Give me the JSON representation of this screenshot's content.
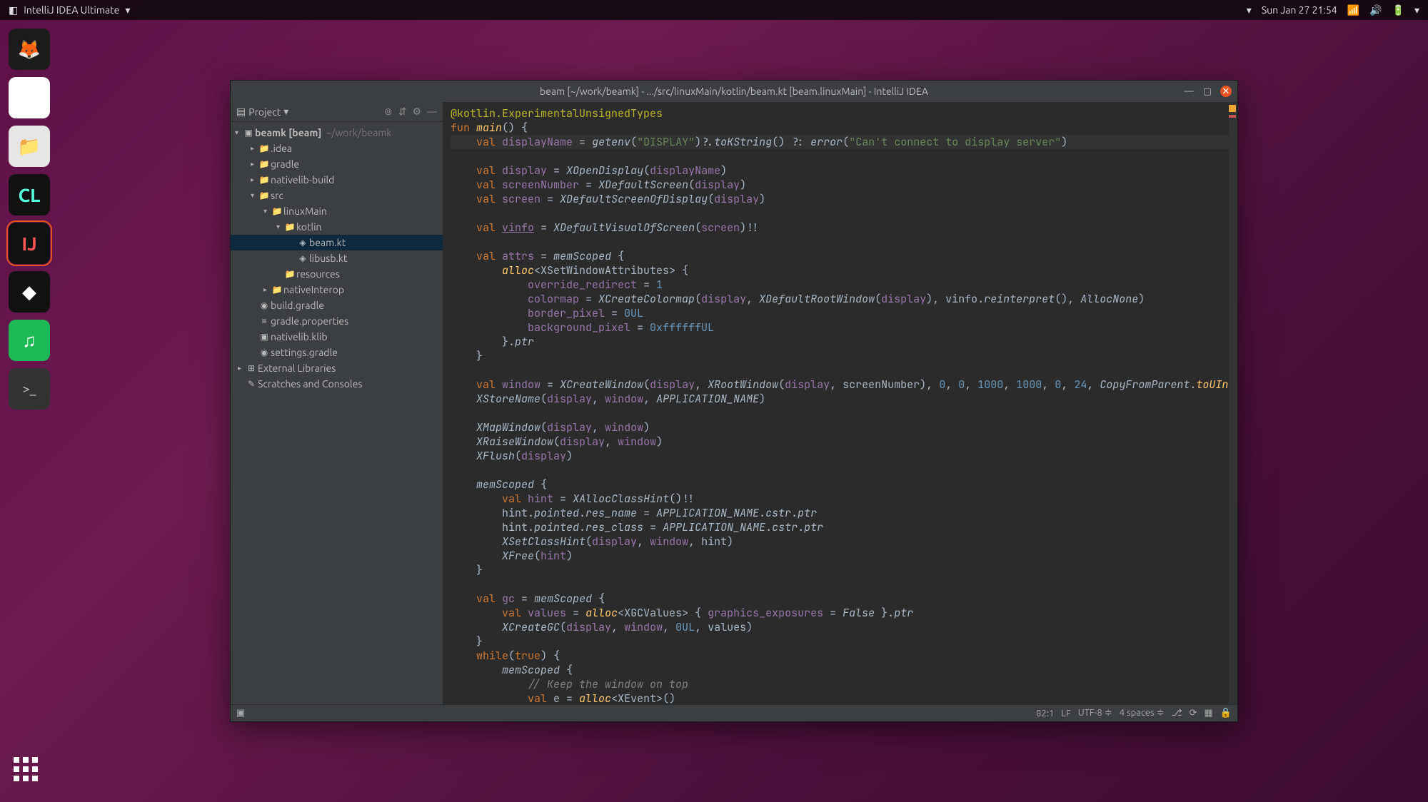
{
  "topbar": {
    "app_name": "IntelliJ IDEA Ultimate",
    "datetime": "Sun Jan 27  21:54"
  },
  "dock": {
    "firefox": "firefox",
    "chrome": "chrome",
    "files": "files",
    "clion": "CL",
    "intellij": "IJ",
    "jbtool": "jetbrains-toolbox",
    "spotify": "spotify",
    "terminal": "terminal",
    "showapps": "show-applications"
  },
  "ide": {
    "title": "beam [~/work/beamk] - .../src/linuxMain/kotlin/beam.kt [beam.linuxMain] - IntelliJ IDEA",
    "sidebar": {
      "title": "Project",
      "root": {
        "name": "beamk [beam]",
        "path": "~/work/beamk"
      },
      "items": [
        {
          "indent": 1,
          "name": ".idea",
          "type": "folder",
          "expand": "closed"
        },
        {
          "indent": 1,
          "name": "gradle",
          "type": "folder",
          "expand": "closed"
        },
        {
          "indent": 1,
          "name": "nativelib-build",
          "type": "folder",
          "expand": "closed"
        },
        {
          "indent": 1,
          "name": "src",
          "type": "folder",
          "expand": "open"
        },
        {
          "indent": 2,
          "name": "linuxMain",
          "type": "srcfolder",
          "expand": "open"
        },
        {
          "indent": 3,
          "name": "kotlin",
          "type": "srcfolder",
          "expand": "open"
        },
        {
          "indent": 4,
          "name": "beam.kt",
          "type": "kt",
          "selected": true
        },
        {
          "indent": 4,
          "name": "libusb.kt",
          "type": "kt"
        },
        {
          "indent": 3,
          "name": "resources",
          "type": "resfolder"
        },
        {
          "indent": 2,
          "name": "nativeInterop",
          "type": "srcfolder",
          "expand": "closed"
        },
        {
          "indent": 1,
          "name": "build.gradle",
          "type": "gradle"
        },
        {
          "indent": 1,
          "name": "gradle.properties",
          "type": "prop"
        },
        {
          "indent": 1,
          "name": "nativelib.klib",
          "type": "lib"
        },
        {
          "indent": 1,
          "name": "settings.gradle",
          "type": "gradle"
        },
        {
          "indent": 0,
          "name": "External Libraries",
          "type": "ext",
          "expand": "closed"
        },
        {
          "indent": 0,
          "name": "Scratches and Consoles",
          "type": "scratch"
        }
      ]
    },
    "status": {
      "pos": "82:1",
      "sep": "LF",
      "enc": "UTF-8",
      "indent": "4 spaces"
    },
    "code_tokens": [
      [
        {
          "t": "@kotlin.ExperimentalUnsignedTypes",
          "c": "ann"
        }
      ],
      [
        {
          "t": "fun ",
          "c": "kw"
        },
        {
          "t": "main",
          "c": "fn"
        },
        {
          "t": "() {",
          "c": ""
        }
      ],
      [
        {
          "t": "    ",
          "c": ""
        },
        {
          "t": "val ",
          "c": "kw"
        },
        {
          "t": "displayName",
          "c": "prop"
        },
        {
          "t": " = ",
          "c": ""
        },
        {
          "t": "getenv",
          "c": "typ"
        },
        {
          "t": "(",
          "c": ""
        },
        {
          "t": "\"DISPLAY\"",
          "c": "str"
        },
        {
          "t": ")?.",
          "c": ""
        },
        {
          "t": "toKString",
          "c": "typ"
        },
        {
          "t": "() ?: ",
          "c": ""
        },
        {
          "t": "error",
          "c": "typ"
        },
        {
          "t": "(",
          "c": ""
        },
        {
          "t": "\"Can't connect to display server\"",
          "c": "str"
        },
        {
          "t": ")",
          "c": ""
        }
      ],
      [],
      [
        {
          "t": "    ",
          "c": ""
        },
        {
          "t": "val ",
          "c": "kw"
        },
        {
          "t": "display",
          "c": "prop"
        },
        {
          "t": " = ",
          "c": ""
        },
        {
          "t": "XOpenDisplay",
          "c": "typ"
        },
        {
          "t": "(",
          "c": ""
        },
        {
          "t": "displayName",
          "c": "prop"
        },
        {
          "t": ")",
          "c": ""
        }
      ],
      [
        {
          "t": "    ",
          "c": ""
        },
        {
          "t": "val ",
          "c": "kw"
        },
        {
          "t": "screenNumber",
          "c": "prop"
        },
        {
          "t": " = ",
          "c": ""
        },
        {
          "t": "XDefaultScreen",
          "c": "typ"
        },
        {
          "t": "(",
          "c": ""
        },
        {
          "t": "display",
          "c": "prop"
        },
        {
          "t": ")",
          "c": ""
        }
      ],
      [
        {
          "t": "    ",
          "c": ""
        },
        {
          "t": "val ",
          "c": "kw"
        },
        {
          "t": "screen",
          "c": "prop"
        },
        {
          "t": " = ",
          "c": ""
        },
        {
          "t": "XDefaultScreenOfDisplay",
          "c": "typ"
        },
        {
          "t": "(",
          "c": ""
        },
        {
          "t": "display",
          "c": "prop"
        },
        {
          "t": ")",
          "c": ""
        }
      ],
      [],
      [
        {
          "t": "    ",
          "c": ""
        },
        {
          "t": "val ",
          "c": "kw"
        },
        {
          "t": "vinfo",
          "c": "prop und"
        },
        {
          "t": " = ",
          "c": ""
        },
        {
          "t": "XDefaultVisualOfScreen",
          "c": "typ"
        },
        {
          "t": "(",
          "c": ""
        },
        {
          "t": "screen",
          "c": "prop"
        },
        {
          "t": ")!!",
          "c": ""
        }
      ],
      [],
      [
        {
          "t": "    ",
          "c": ""
        },
        {
          "t": "val ",
          "c": "kw"
        },
        {
          "t": "attrs",
          "c": "prop"
        },
        {
          "t": " = ",
          "c": ""
        },
        {
          "t": "memScoped ",
          "c": "typ"
        },
        {
          "t": "{",
          "c": ""
        }
      ],
      [
        {
          "t": "        ",
          "c": ""
        },
        {
          "t": "alloc",
          "c": "fn"
        },
        {
          "t": "<",
          "c": ""
        },
        {
          "t": "XSetWindowAttributes",
          "c": ""
        },
        {
          "t": "> {",
          "c": ""
        }
      ],
      [
        {
          "t": "            ",
          "c": ""
        },
        {
          "t": "override_redirect",
          "c": "prop"
        },
        {
          "t": " = ",
          "c": ""
        },
        {
          "t": "1",
          "c": "num"
        }
      ],
      [
        {
          "t": "            ",
          "c": ""
        },
        {
          "t": "colormap",
          "c": "prop"
        },
        {
          "t": " = ",
          "c": ""
        },
        {
          "t": "XCreateColormap",
          "c": "typ"
        },
        {
          "t": "(",
          "c": ""
        },
        {
          "t": "display",
          "c": "prop"
        },
        {
          "t": ", ",
          "c": ""
        },
        {
          "t": "XDefaultRootWindow",
          "c": "typ"
        },
        {
          "t": "(",
          "c": ""
        },
        {
          "t": "display",
          "c": "prop"
        },
        {
          "t": "), vinfo.",
          "c": ""
        },
        {
          "t": "reinterpret",
          "c": "typ"
        },
        {
          "t": "(), ",
          "c": ""
        },
        {
          "t": "AllocNone",
          "c": "typ"
        },
        {
          "t": ")",
          "c": ""
        }
      ],
      [
        {
          "t": "            ",
          "c": ""
        },
        {
          "t": "border_pixel",
          "c": "prop"
        },
        {
          "t": " = ",
          "c": ""
        },
        {
          "t": "0UL",
          "c": "num"
        }
      ],
      [
        {
          "t": "            ",
          "c": ""
        },
        {
          "t": "background_pixel",
          "c": "prop"
        },
        {
          "t": " = ",
          "c": ""
        },
        {
          "t": "0xffffffUL",
          "c": "num"
        }
      ],
      [
        {
          "t": "        }.",
          "c": ""
        },
        {
          "t": "ptr",
          "c": "typ"
        }
      ],
      [
        {
          "t": "    }",
          "c": ""
        }
      ],
      [],
      [
        {
          "t": "    ",
          "c": ""
        },
        {
          "t": "val ",
          "c": "kw"
        },
        {
          "t": "window",
          "c": "prop"
        },
        {
          "t": " = ",
          "c": ""
        },
        {
          "t": "XCreateWindow",
          "c": "typ"
        },
        {
          "t": "(",
          "c": ""
        },
        {
          "t": "display",
          "c": "prop"
        },
        {
          "t": ", ",
          "c": ""
        },
        {
          "t": "XRootWindow",
          "c": "typ"
        },
        {
          "t": "(",
          "c": ""
        },
        {
          "t": "display",
          "c": "prop"
        },
        {
          "t": ", screenNumber), ",
          "c": ""
        },
        {
          "t": "0",
          "c": "num"
        },
        {
          "t": ", ",
          "c": ""
        },
        {
          "t": "0",
          "c": "num"
        },
        {
          "t": ", ",
          "c": ""
        },
        {
          "t": "1000",
          "c": "num"
        },
        {
          "t": ", ",
          "c": ""
        },
        {
          "t": "1000",
          "c": "num"
        },
        {
          "t": ", ",
          "c": ""
        },
        {
          "t": "0",
          "c": "num"
        },
        {
          "t": ", ",
          "c": ""
        },
        {
          "t": "24",
          "c": "num"
        },
        {
          "t": ", ",
          "c": ""
        },
        {
          "t": "CopyFromParent",
          "c": "typ"
        },
        {
          "t": ".",
          "c": ""
        },
        {
          "t": "toUInt",
          "c": "fn"
        }
      ],
      [
        {
          "t": "    ",
          "c": ""
        },
        {
          "t": "XStoreName",
          "c": "typ"
        },
        {
          "t": "(",
          "c": ""
        },
        {
          "t": "display",
          "c": "prop"
        },
        {
          "t": ", ",
          "c": ""
        },
        {
          "t": "window",
          "c": "prop"
        },
        {
          "t": ", ",
          "c": ""
        },
        {
          "t": "APPLICATION_NAME",
          "c": "typ"
        },
        {
          "t": ")",
          "c": ""
        }
      ],
      [],
      [
        {
          "t": "    ",
          "c": ""
        },
        {
          "t": "XMapWindow",
          "c": "typ"
        },
        {
          "t": "(",
          "c": ""
        },
        {
          "t": "display",
          "c": "prop"
        },
        {
          "t": ", ",
          "c": ""
        },
        {
          "t": "window",
          "c": "prop"
        },
        {
          "t": ")",
          "c": ""
        }
      ],
      [
        {
          "t": "    ",
          "c": ""
        },
        {
          "t": "XRaiseWindow",
          "c": "typ"
        },
        {
          "t": "(",
          "c": ""
        },
        {
          "t": "display",
          "c": "prop"
        },
        {
          "t": ", ",
          "c": ""
        },
        {
          "t": "window",
          "c": "prop"
        },
        {
          "t": ")",
          "c": ""
        }
      ],
      [
        {
          "t": "    ",
          "c": ""
        },
        {
          "t": "XFlush",
          "c": "typ"
        },
        {
          "t": "(",
          "c": ""
        },
        {
          "t": "display",
          "c": "prop"
        },
        {
          "t": ")",
          "c": ""
        }
      ],
      [],
      [
        {
          "t": "    ",
          "c": ""
        },
        {
          "t": "memScoped ",
          "c": "typ"
        },
        {
          "t": "{",
          "c": ""
        }
      ],
      [
        {
          "t": "        ",
          "c": ""
        },
        {
          "t": "val ",
          "c": "kw"
        },
        {
          "t": "hint",
          "c": "prop"
        },
        {
          "t": " = ",
          "c": ""
        },
        {
          "t": "XAllocClassHint",
          "c": "typ"
        },
        {
          "t": "()!!",
          "c": ""
        }
      ],
      [
        {
          "t": "        hint.",
          "c": ""
        },
        {
          "t": "pointed",
          "c": "typ"
        },
        {
          "t": ".",
          "c": ""
        },
        {
          "t": "res_name",
          "c": "typ"
        },
        {
          "t": " = ",
          "c": ""
        },
        {
          "t": "APPLICATION_NAME",
          "c": "typ"
        },
        {
          "t": ".",
          "c": ""
        },
        {
          "t": "cstr",
          "c": "typ"
        },
        {
          "t": ".",
          "c": ""
        },
        {
          "t": "ptr",
          "c": "typ"
        }
      ],
      [
        {
          "t": "        hint.",
          "c": ""
        },
        {
          "t": "pointed",
          "c": "typ"
        },
        {
          "t": ".",
          "c": ""
        },
        {
          "t": "res_class",
          "c": "typ"
        },
        {
          "t": " = ",
          "c": ""
        },
        {
          "t": "APPLICATION_NAME",
          "c": "typ"
        },
        {
          "t": ".",
          "c": ""
        },
        {
          "t": "cstr",
          "c": "typ"
        },
        {
          "t": ".",
          "c": ""
        },
        {
          "t": "ptr",
          "c": "typ"
        }
      ],
      [
        {
          "t": "        ",
          "c": ""
        },
        {
          "t": "XSetClassHint",
          "c": "typ"
        },
        {
          "t": "(",
          "c": ""
        },
        {
          "t": "display",
          "c": "prop"
        },
        {
          "t": ", ",
          "c": ""
        },
        {
          "t": "window",
          "c": "prop"
        },
        {
          "t": ", hint)",
          "c": ""
        }
      ],
      [
        {
          "t": "        ",
          "c": ""
        },
        {
          "t": "XFree",
          "c": "typ"
        },
        {
          "t": "(",
          "c": ""
        },
        {
          "t": "hint",
          "c": "prop"
        },
        {
          "t": ")",
          "c": ""
        }
      ],
      [
        {
          "t": "    }",
          "c": ""
        }
      ],
      [],
      [
        {
          "t": "    ",
          "c": ""
        },
        {
          "t": "val ",
          "c": "kw"
        },
        {
          "t": "gc",
          "c": "prop"
        },
        {
          "t": " = ",
          "c": ""
        },
        {
          "t": "memScoped ",
          "c": "typ"
        },
        {
          "t": "{",
          "c": ""
        }
      ],
      [
        {
          "t": "        ",
          "c": ""
        },
        {
          "t": "val ",
          "c": "kw"
        },
        {
          "t": "values",
          "c": "prop"
        },
        {
          "t": " = ",
          "c": ""
        },
        {
          "t": "alloc",
          "c": "fn"
        },
        {
          "t": "<",
          "c": ""
        },
        {
          "t": "XGCValues",
          "c": ""
        },
        {
          "t": "> { ",
          "c": ""
        },
        {
          "t": "graphics_exposures",
          "c": "prop"
        },
        {
          "t": " = ",
          "c": ""
        },
        {
          "t": "False",
          "c": "typ"
        },
        {
          "t": " }.",
          "c": ""
        },
        {
          "t": "ptr",
          "c": "typ"
        }
      ],
      [
        {
          "t": "        ",
          "c": ""
        },
        {
          "t": "XCreateGC",
          "c": "typ"
        },
        {
          "t": "(",
          "c": ""
        },
        {
          "t": "display",
          "c": "prop"
        },
        {
          "t": ", ",
          "c": ""
        },
        {
          "t": "window",
          "c": "prop"
        },
        {
          "t": ", ",
          "c": ""
        },
        {
          "t": "0UL",
          "c": "num"
        },
        {
          "t": ", values)",
          "c": ""
        }
      ],
      [
        {
          "t": "    }",
          "c": ""
        }
      ],
      [
        {
          "t": "    ",
          "c": ""
        },
        {
          "t": "while",
          "c": "kw"
        },
        {
          "t": "(",
          "c": ""
        },
        {
          "t": "true",
          "c": "kw"
        },
        {
          "t": ") {",
          "c": ""
        }
      ],
      [
        {
          "t": "        ",
          "c": ""
        },
        {
          "t": "memScoped ",
          "c": "typ"
        },
        {
          "t": "{",
          "c": ""
        }
      ],
      [
        {
          "t": "            ",
          "c": ""
        },
        {
          "t": "// Keep the window on top",
          "c": "cmt"
        }
      ],
      [
        {
          "t": "            ",
          "c": ""
        },
        {
          "t": "val ",
          "c": "kw"
        },
        {
          "t": "e = ",
          "c": ""
        },
        {
          "t": "alloc",
          "c": "fn"
        },
        {
          "t": "<XEvent>()",
          "c": ""
        }
      ]
    ]
  }
}
